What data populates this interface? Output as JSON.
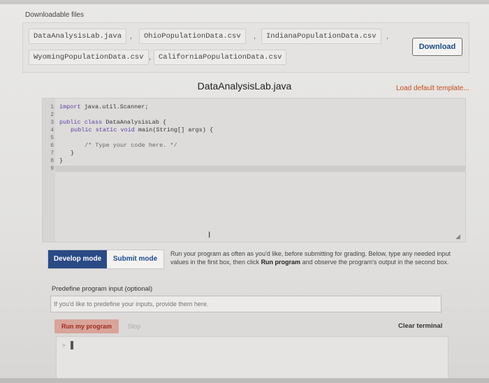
{
  "files_section": {
    "label": "Downloadable files",
    "files": [
      "DataAnalysisLab.java",
      "OhioPopulationData.csv",
      "IndianaPopulationData.csv",
      "WyomingPopulationData.csv",
      "CaliforniaPopulationData.csv"
    ],
    "separator": ",",
    "download_label": "Download"
  },
  "editor": {
    "filename": "DataAnalysisLab.java",
    "load_template_label": "Load default template...",
    "line_numbers": [
      "1",
      "2",
      "3",
      "4",
      "5",
      "6",
      "7",
      "8",
      "9"
    ],
    "code": {
      "l1_kw": "import",
      "l1_rest": " java.util.Scanner;",
      "l3_kw": "public class",
      "l3_rest": " DataAnalysisLab {",
      "l4_kw": "public static void",
      "l4_rest": " main(String[] args) {",
      "l6": "/* Type your code here. */",
      "l7": "}",
      "l8": "}"
    },
    "cursor_glyph": "I"
  },
  "modes": {
    "develop_label": "Develop mode",
    "submit_label": "Submit mode",
    "description_1": "Run your program as often as you'd like, before submitting for grading. Below, type any needed input values in the first box, then click ",
    "description_bold": "Run program",
    "description_2": " and observe the program's output in the second box."
  },
  "input_section": {
    "label": "Predefine program input (optional)",
    "placeholder": "If you'd like to predefine your inputs, provide them here."
  },
  "run": {
    "run_label": "Run my program",
    "stop_label": "Stop",
    "clear_label": "Clear terminal",
    "prompt": ">"
  },
  "colors": {
    "develop_bg": "#2a4a86",
    "link_blue": "#1c4a8c",
    "template_orange": "#c44c1e",
    "run_red": "#9d2b1e"
  }
}
